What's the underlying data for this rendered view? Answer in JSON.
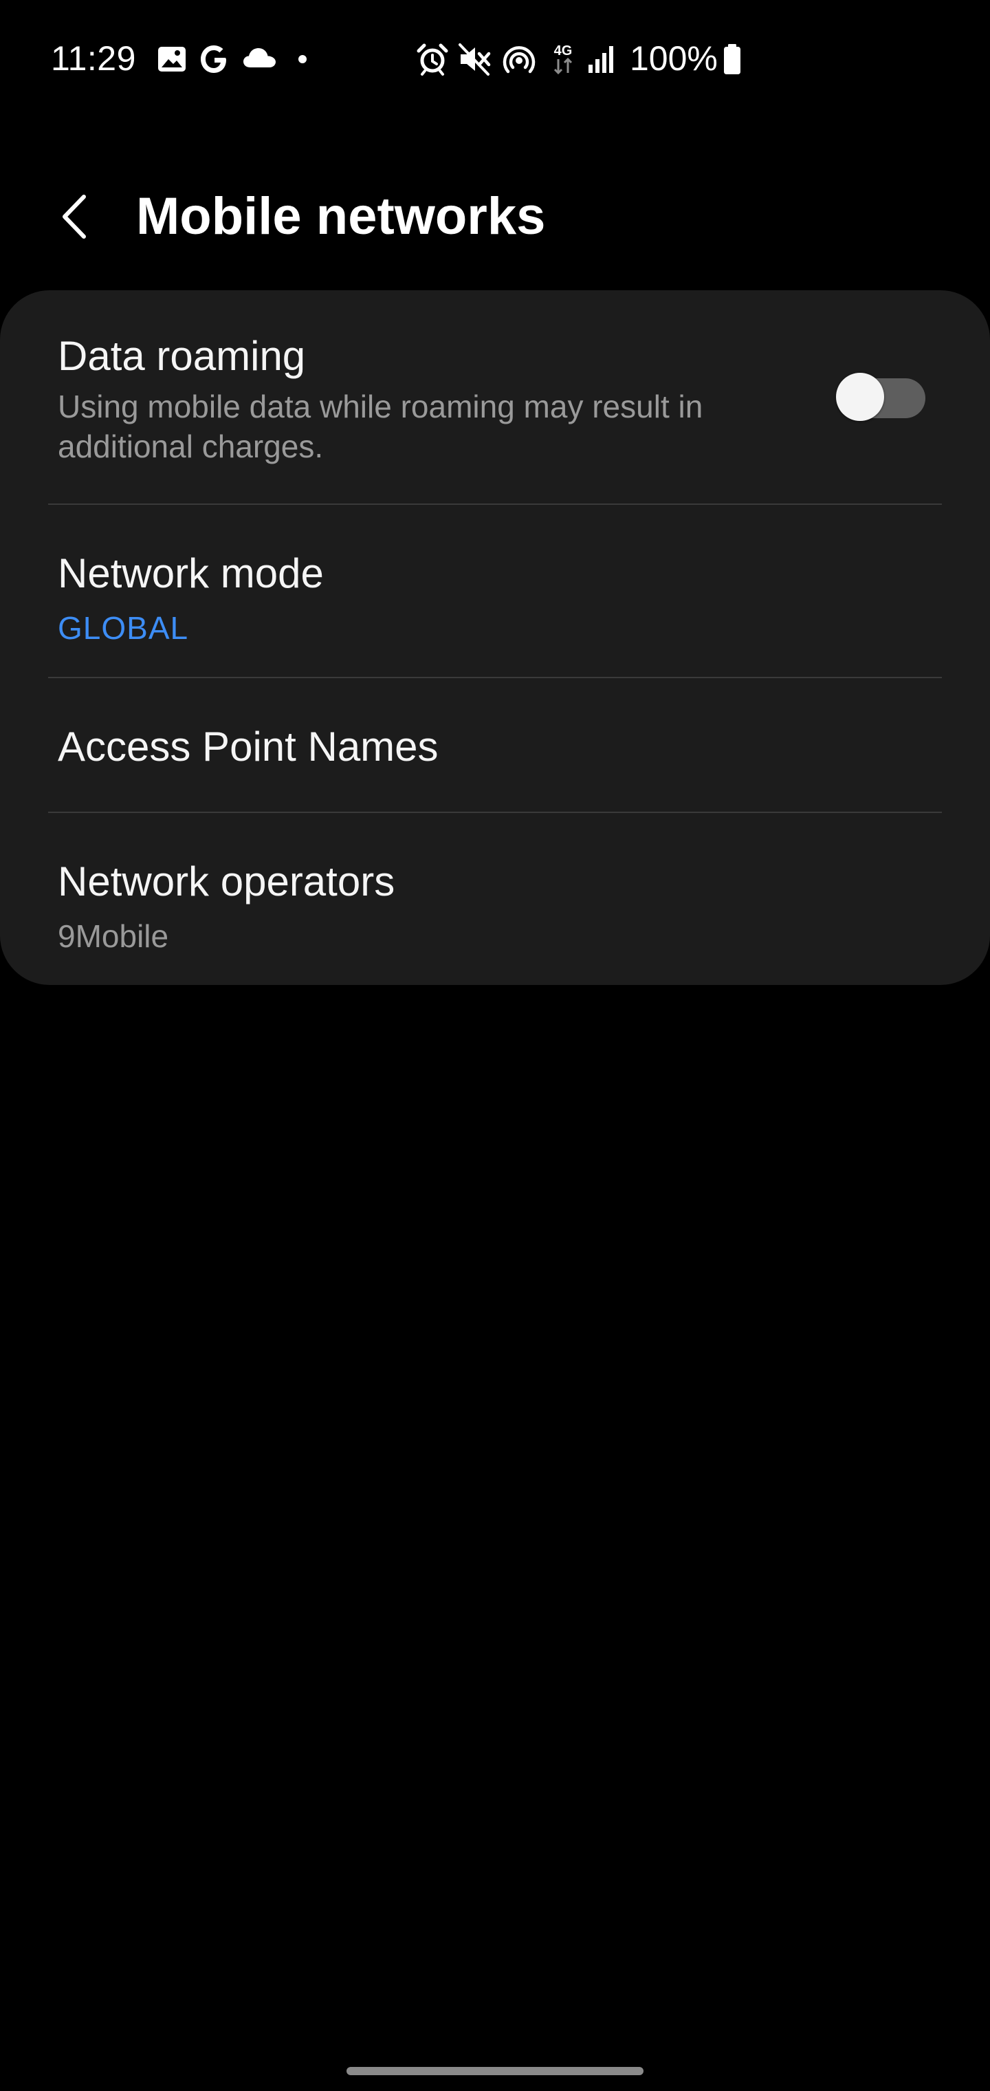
{
  "status_bar": {
    "time": "11:29",
    "battery_percent": "100%",
    "network_type": "4G",
    "left_icons": [
      "gallery-icon",
      "google-icon",
      "cloud-icon",
      "dot-icon"
    ],
    "right_icons": [
      "alarm-icon",
      "mute-icon",
      "hotspot-icon",
      "4g-data-icon",
      "signal-icon",
      "battery-icon"
    ],
    "battery_level": 1.0
  },
  "header": {
    "title": "Mobile networks",
    "back_icon": "chevron-left-icon"
  },
  "settings": {
    "data_roaming": {
      "title": "Data roaming",
      "description": "Using mobile data while roaming may result in additional charges.",
      "enabled": false
    },
    "network_mode": {
      "title": "Network mode",
      "value": "GLOBAL"
    },
    "access_point_names": {
      "title": "Access Point Names"
    },
    "network_operators": {
      "title": "Network operators",
      "value": "9Mobile"
    }
  },
  "colors": {
    "background": "#000000",
    "card": "#1c1c1c",
    "accent": "#3d8df5",
    "secondary_text": "#9a9a9a",
    "toggle_off_track": "#5e5e5e"
  }
}
